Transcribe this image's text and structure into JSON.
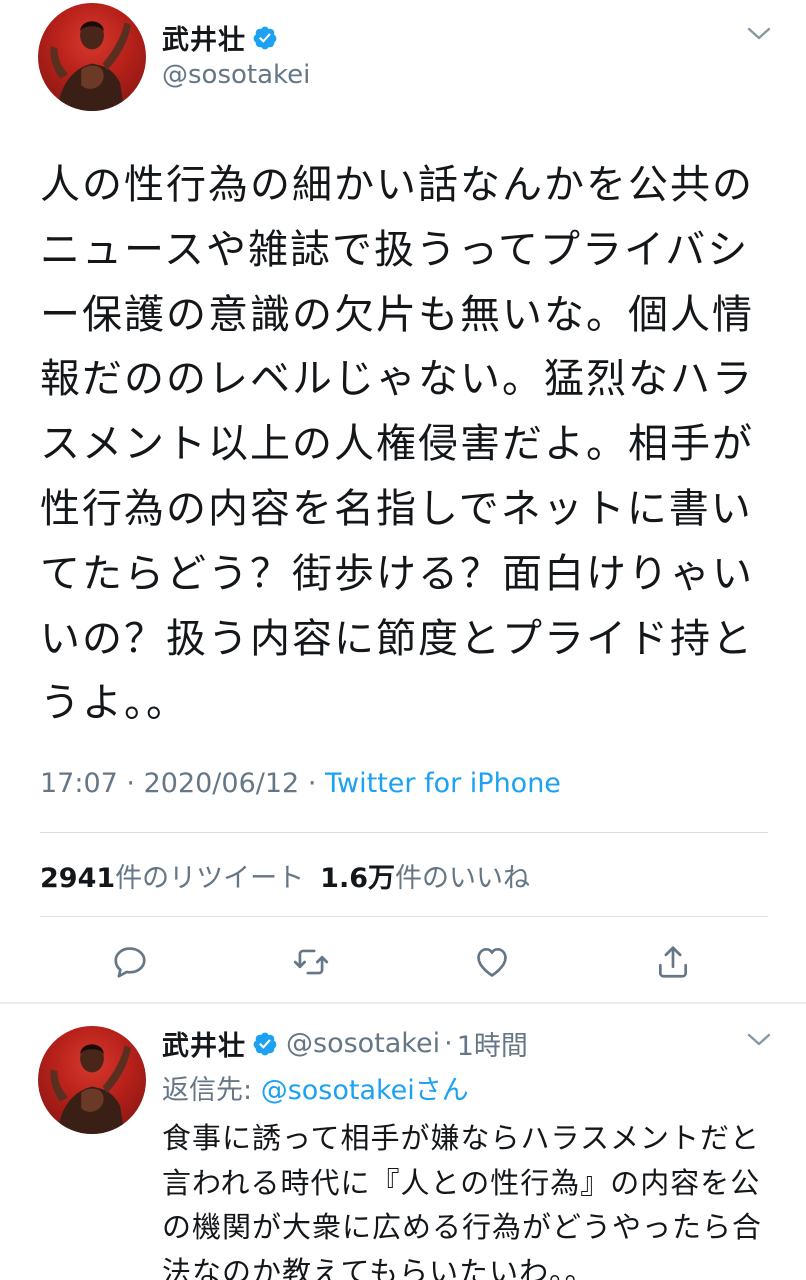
{
  "tweet": {
    "author_name": "武井壮",
    "author_handle": "@sosotakei",
    "text": "人の性行為の細かい話なんかを公共の\nニュースや雑誌で扱うってプライバシ\nー保護の意識の欠片も無いな。個人情\n報だののレベルじゃない。猛烈なハラ\nスメント以上の人権侵害だよ。相手が\n性行為の内容を名指しでネットに書い\nてたらどう？街歩ける？面白けりゃい\nいの？扱う内容に節度とプライド持と\nうよ。。",
    "time": "17:07",
    "date": "2020/06/12",
    "separator": "·",
    "source": "Twitter for iPhone",
    "retweet_count": "2941",
    "retweet_label": "件のリツイート",
    "like_count": "1.6万",
    "like_label": "件のいいね"
  },
  "reply": {
    "author_name": "武井壮",
    "author_handle": "@sosotakei",
    "separator": "·",
    "time_ago": "1時間",
    "reply_to_label": "返信先: ",
    "reply_to_mention": "@sosotakeiさん",
    "text": "食事に誘って相手が嫌ならハラスメントだと\n言われる時代に『人との性行為』の内容を公\nの機関が大衆に広める行為がどうやったら合\n法なのか教えてもらいたいわ。。"
  },
  "icons": {
    "verified": "verified-badge-icon",
    "caret": "chevron-down-icon",
    "reply": "reply-icon",
    "retweet": "retweet-icon",
    "like": "heart-icon",
    "share": "share-icon"
  },
  "colors": {
    "accent": "#1da1f2",
    "muted": "#657786",
    "text": "#14171a",
    "avatar_bg": "#c0241c"
  }
}
